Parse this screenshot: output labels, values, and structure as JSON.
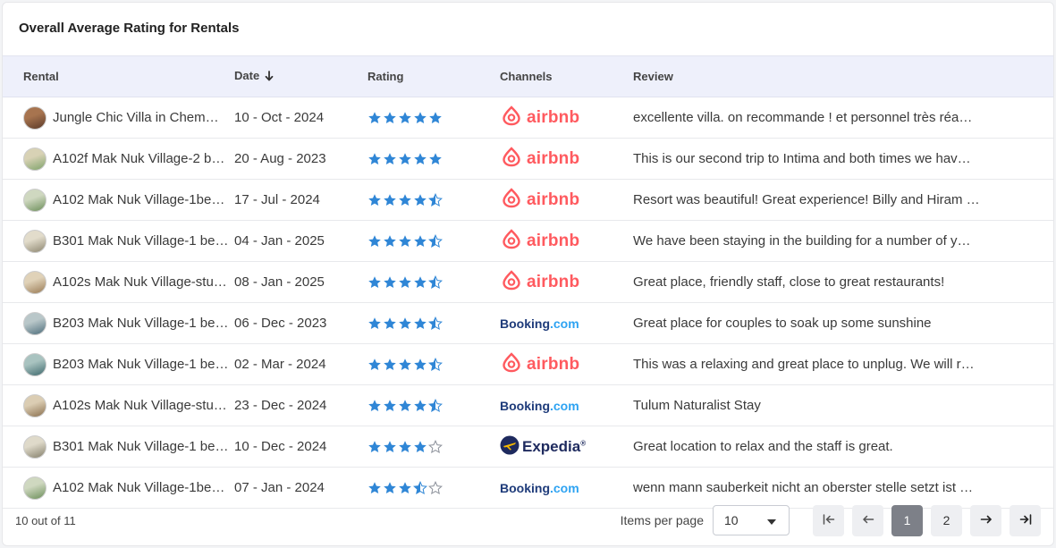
{
  "title": "Overall Average Rating for Rentals",
  "columns": {
    "rental": "Rental",
    "date": "Date",
    "rating": "Rating",
    "channels": "Channels",
    "review": "Review"
  },
  "rows": [
    {
      "rental": "Jungle Chic Villa in Chem…",
      "date": "10 - Oct - 2024",
      "rating": 5,
      "channel": "airbnb",
      "review": "excellente villa. on recommande ! et personnel très réa…"
    },
    {
      "rental": "A102f Mak Nuk Village-2 b…",
      "date": "20 - Aug - 2023",
      "rating": 5,
      "channel": "airbnb",
      "review": "This is our second trip to Intima and both times we hav…"
    },
    {
      "rental": "A102 Mak Nuk Village-1be…",
      "date": "17 - Jul - 2024",
      "rating": 4.5,
      "channel": "airbnb",
      "review": "Resort was beautiful! Great experience! Billy and Hiram …"
    },
    {
      "rental": "B301 Mak Nuk Village-1 be…",
      "date": "04 - Jan - 2025",
      "rating": 4.5,
      "channel": "airbnb",
      "review": "We have been staying in the building for a number of y…"
    },
    {
      "rental": "A102s Mak Nuk Village-stu…",
      "date": "08 - Jan - 2025",
      "rating": 4.5,
      "channel": "airbnb",
      "review": "Great place, friendly staff, close to great restaurants!"
    },
    {
      "rental": "B203 Mak Nuk Village-1 be…",
      "date": "06 - Dec - 2023",
      "rating": 4.5,
      "channel": "booking",
      "review": "Great place for couples to soak up some sunshine"
    },
    {
      "rental": "B203 Mak Nuk Village-1 be…",
      "date": "02 - Mar - 2024",
      "rating": 4.5,
      "channel": "airbnb",
      "review": "This was a relaxing and great place to unplug. We will r…"
    },
    {
      "rental": "A102s Mak Nuk Village-stu…",
      "date": "23 - Dec - 2024",
      "rating": 4.5,
      "channel": "booking",
      "review": "Tulum Naturalist Stay"
    },
    {
      "rental": "B301 Mak Nuk Village-1 be…",
      "date": "10 - Dec - 2024",
      "rating": 4,
      "channel": "expedia",
      "review": "Great location to relax and the staff is great."
    },
    {
      "rental": "A102 Mak Nuk Village-1be…",
      "date": "07 - Jan - 2024",
      "rating": 3.5,
      "channel": "booking",
      "review": "wenn mann sauberkeit nicht an oberster stelle setzt ist …"
    }
  ],
  "channel_labels": {
    "airbnb": "airbnb",
    "booking_main": "Booking",
    "booking_dot": ".com",
    "expedia": "Expedia",
    "expedia_reg": "®"
  },
  "colors": {
    "star": "#2f86d6",
    "airbnb": "#ff5a5f",
    "booking": "#1e3b7a",
    "expedia": "#1e2a5e"
  },
  "footer": {
    "count": "10 out of 11",
    "items_per_page_label": "Items per page",
    "items_per_page_value": "10",
    "pages": [
      "1",
      "2"
    ],
    "current_page": "1"
  }
}
